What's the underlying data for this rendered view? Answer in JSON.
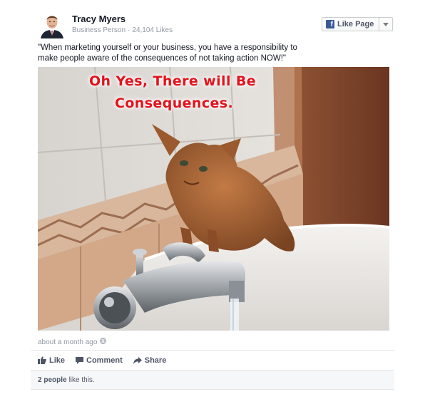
{
  "author": {
    "name": "Tracy Myers",
    "category": "Business Person",
    "separator": "·",
    "likes": "24,104 Likes"
  },
  "like_page_button": {
    "label": "Like Page",
    "brand_letter": "f",
    "brand_color": "#3b5998"
  },
  "post": {
    "caption": "\"When marketing yourself or your business, you have a responsibility to make people aware of the consequences of not taking action NOW!\"",
    "timestamp": "about a month ago",
    "privacy_icon": "globe-icon"
  },
  "photo": {
    "line1": "Oh Yes, There will Be",
    "line2": "Consequences.",
    "text_color": "#e4121b"
  },
  "actions": [
    {
      "label": "Like",
      "icon": "thumbs-up-icon"
    },
    {
      "label": "Comment",
      "icon": "comment-icon"
    },
    {
      "label": "Share",
      "icon": "share-icon"
    }
  ],
  "likes_summary": {
    "count": "2 people",
    "text": "like this."
  }
}
